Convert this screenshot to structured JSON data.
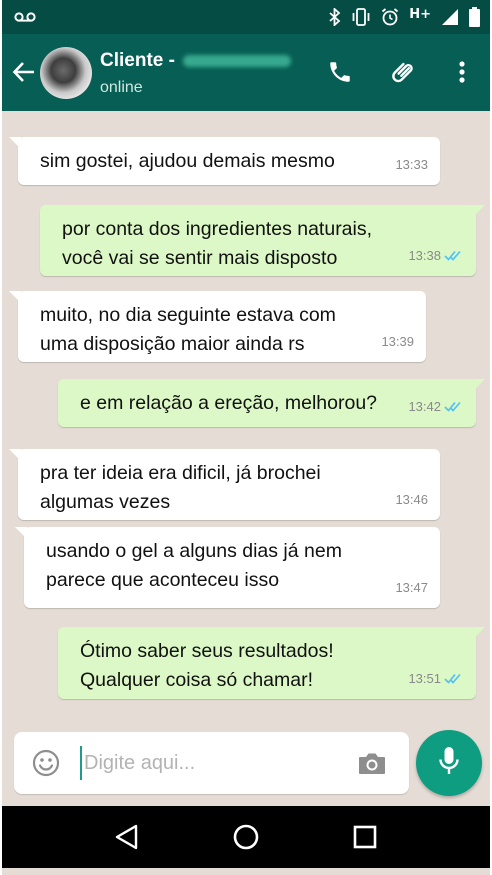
{
  "header": {
    "contact_name": "Cliente -",
    "status": "online"
  },
  "messages": [
    {
      "direction": "in",
      "lines": [
        "sim gostei, ajudou demais mesmo"
      ],
      "time": "13:33",
      "read": false
    },
    {
      "direction": "out",
      "lines": [
        "por conta dos ingredientes naturais,",
        "você vai se sentir mais disposto"
      ],
      "time": "13:38",
      "read": true
    },
    {
      "direction": "in",
      "lines": [
        "muito, no dia seguinte estava com",
        "uma disposição maior ainda rs"
      ],
      "time": "13:39",
      "read": false
    },
    {
      "direction": "out",
      "lines": [
        "e em relação a ereção, melhorou?"
      ],
      "time": "13:42",
      "read": true
    },
    {
      "direction": "in",
      "lines": [
        "pra ter ideia era dificil, já brochei",
        "algumas vezes"
      ],
      "time": "13:46",
      "read": false
    },
    {
      "direction": "in",
      "lines": [
        "usando o gel a alguns dias já nem",
        "parece que aconteceu isso"
      ],
      "time": "13:47",
      "read": false
    },
    {
      "direction": "out",
      "lines": [
        "Ótimo saber seus resultados!",
        "Qualquer coisa só chamar!"
      ],
      "time": "13:51",
      "read": true
    }
  ],
  "composer": {
    "placeholder": "Digite aqui..."
  },
  "statusbar": {
    "network": "H+"
  },
  "colors": {
    "header": "#075e54",
    "statusbar": "#054d44",
    "chat_background": "#e5ddd5",
    "outgoing_bubble": "#dcf8c6",
    "incoming_bubble": "#ffffff",
    "read_ticks": "#4fc3f7",
    "fab": "#0f9d82"
  },
  "icons": {
    "voicemail": "voicemail-icon",
    "bluetooth": "bluetooth-icon",
    "vibrate": "vibrate-icon",
    "alarm": "alarm-icon",
    "signal": "signal-icon",
    "battery": "battery-icon",
    "back": "back-arrow-icon",
    "call": "phone-icon",
    "attach": "paperclip-icon",
    "menu": "more-vert-icon",
    "emoji": "emoji-icon",
    "camera": "camera-icon",
    "mic": "mic-icon",
    "nav_back": "nav-back-icon",
    "nav_home": "nav-home-icon",
    "nav_recents": "nav-recents-icon"
  }
}
